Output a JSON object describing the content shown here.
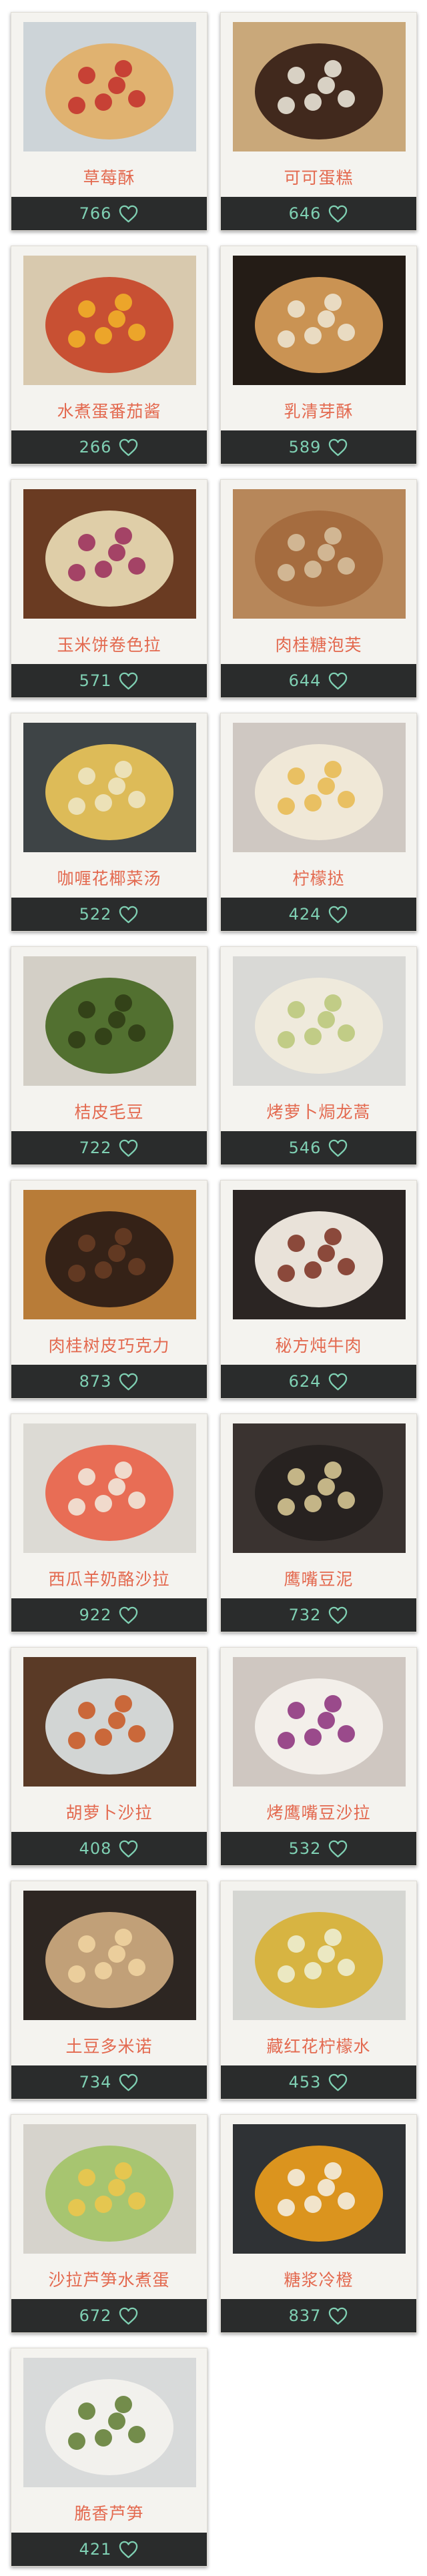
{
  "colors": {
    "title": "#e3694f",
    "count": "#7fd0b3",
    "heart": "#7fd0b3",
    "bar": "#2a2c2c"
  },
  "recipes": [
    {
      "title": "草莓酥",
      "likes": "766",
      "photo": "strawberry-shortcake",
      "bg": "#cdd4d8",
      "dish": "#e0b06a",
      "accent": "#c22d2a"
    },
    {
      "title": "可可蛋糕",
      "likes": "646",
      "photo": "cocoa-cupcakes",
      "bg": "#c9a87a",
      "dish": "#3a2218",
      "accent": "#f3eee2"
    },
    {
      "title": "水煮蛋番茄酱",
      "likes": "266",
      "photo": "egg-tomato-sauce",
      "bg": "#d8c9ae",
      "dish": "#c74a2c",
      "accent": "#f2b429"
    },
    {
      "title": "乳清芽酥",
      "likes": "589",
      "photo": "ricotta-toast",
      "bg": "#241c16",
      "dish": "#d49a56",
      "accent": "#eee8d6"
    },
    {
      "title": "玉米饼卷色拉",
      "likes": "571",
      "photo": "tacos",
      "bg": "#6a3b22",
      "dish": "#e6d6b0",
      "accent": "#9a2a5a"
    },
    {
      "title": "肉桂糖泡芙",
      "likes": "644",
      "photo": "cinnamon-puffs",
      "bg": "#b7875a",
      "dish": "#a36a3e",
      "accent": "#d8c3a2"
    },
    {
      "title": "咖喱花椰菜汤",
      "likes": "522",
      "photo": "cauliflower-soup",
      "bg": "#3e4446",
      "dish": "#e6c25a",
      "accent": "#efe8c8"
    },
    {
      "title": "柠檬挞",
      "likes": "424",
      "photo": "lemon-tart",
      "bg": "#cfc8c2",
      "dish": "#f1ead8",
      "accent": "#e8b84e"
    },
    {
      "title": "桔皮毛豆",
      "likes": "722",
      "photo": "edamame",
      "bg": "#d3cfc6",
      "dish": "#4b6a28",
      "accent": "#2e3a14"
    },
    {
      "title": "烤萝卜焗龙蒿",
      "likes": "546",
      "photo": "roasted-radish",
      "bg": "#d9d9d6",
      "dish": "#f0ebdc",
      "accent": "#b8c777"
    },
    {
      "title": "肉桂树皮巧克力",
      "likes": "873",
      "photo": "chocolate-bark",
      "bg": "#b87c38",
      "dish": "#2d1d15",
      "accent": "#6a3d25"
    },
    {
      "title": "秘方炖牛肉",
      "likes": "624",
      "photo": "beef-stew",
      "bg": "#2b2523",
      "dish": "#f3ece4",
      "accent": "#7a2e1e"
    },
    {
      "title": "西瓜羊奶酪沙拉",
      "likes": "922",
      "photo": "watermelon-salad",
      "bg": "#dcdad4",
      "dish": "#e8674e",
      "accent": "#f1ede2"
    },
    {
      "title": "鹰嘴豆泥",
      "likes": "732",
      "photo": "hummus",
      "bg": "#3a3330",
      "dish": "#262220",
      "accent": "#e0cf9a"
    },
    {
      "title": "胡萝卜沙拉",
      "likes": "408",
      "photo": "carrot-salad",
      "bg": "#5a3a26",
      "dish": "#d9dddd",
      "accent": "#c9551f"
    },
    {
      "title": "烤鹰嘴豆沙拉",
      "likes": "532",
      "photo": "chickpea-slaw",
      "bg": "#cfc7c1",
      "dish": "#f4f1ec",
      "accent": "#8a2d7a"
    },
    {
      "title": "土豆多米诺",
      "likes": "734",
      "photo": "potato-tart",
      "bg": "#2d2622",
      "dish": "#c9a77d",
      "accent": "#f2d6a2"
    },
    {
      "title": "藏红花柠檬水",
      "likes": "453",
      "photo": "saffron-lemonade",
      "bg": "#d5d6d2",
      "dish": "#d7b23a",
      "accent": "#eef1d8"
    },
    {
      "title": "沙拉芦笋水煮蛋",
      "likes": "672",
      "photo": "asparagus-egg-salad",
      "bg": "#d6d3cc",
      "dish": "#a4c46a",
      "accent": "#f0c64a"
    },
    {
      "title": "糖浆冷橙",
      "likes": "837",
      "photo": "syrup-oranges",
      "bg": "#2f3235",
      "dish": "#e59a1e",
      "accent": "#f5f2ea"
    },
    {
      "title": "脆香芦笋",
      "likes": "421",
      "photo": "crispy-asparagus",
      "bg": "#d8dada",
      "dish": "#f3f2ee",
      "accent": "#5d7a2e"
    }
  ]
}
